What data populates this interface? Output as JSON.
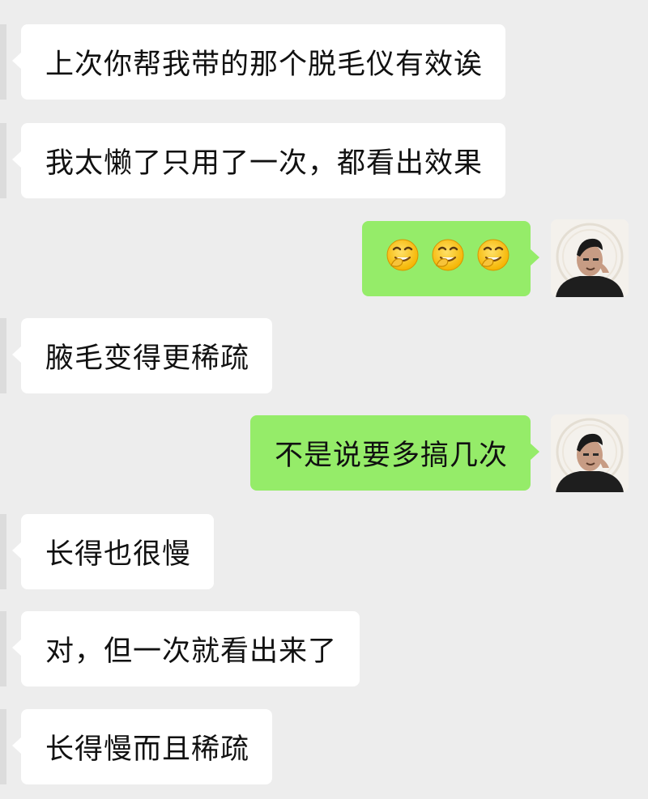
{
  "chat": {
    "messages": [
      {
        "side": "in",
        "text": "上次你帮我带的那个脱毛仪有效诶"
      },
      {
        "side": "in",
        "text": "我太懒了只用了一次，都看出效果"
      },
      {
        "side": "out",
        "emoji": [
          "grimacing-laugh-emoji",
          "grimacing-laugh-emoji",
          "grimacing-laugh-emoji"
        ]
      },
      {
        "side": "in",
        "text": "腋毛变得更稀疏"
      },
      {
        "side": "out",
        "text": "不是说要多搞几次"
      },
      {
        "side": "in",
        "text": "长得也很慢"
      },
      {
        "side": "in",
        "text": "对，但一次就看出来了"
      },
      {
        "side": "in",
        "text": "长得慢而且稀疏"
      }
    ]
  },
  "colors": {
    "background": "#ededed",
    "incoming_bubble": "#ffffff",
    "outgoing_bubble": "#95ec69",
    "text": "#111111"
  }
}
